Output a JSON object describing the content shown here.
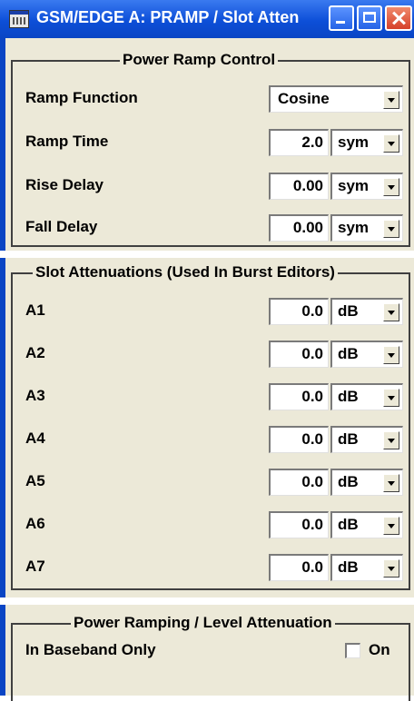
{
  "window": {
    "title": "GSM/EDGE A: PRAMP / Slot Atten"
  },
  "power_ramp_control": {
    "legend": "Power Ramp Control",
    "ramp_function": {
      "label": "Ramp Function",
      "value": "Cosine"
    },
    "ramp_time": {
      "label": "Ramp Time",
      "value": "2.0",
      "unit": "sym"
    },
    "rise_delay": {
      "label": "Rise Delay",
      "value": "0.00",
      "unit": "sym"
    },
    "fall_delay": {
      "label": "Fall Delay",
      "value": "0.00",
      "unit": "sym"
    }
  },
  "slot_attenuations": {
    "legend": "Slot Attenuations (Used In Burst Editors)",
    "items": [
      {
        "label": "A1",
        "value": "0.0",
        "unit": "dB"
      },
      {
        "label": "A2",
        "value": "0.0",
        "unit": "dB"
      },
      {
        "label": "A3",
        "value": "0.0",
        "unit": "dB"
      },
      {
        "label": "A4",
        "value": "0.0",
        "unit": "dB"
      },
      {
        "label": "A5",
        "value": "0.0",
        "unit": "dB"
      },
      {
        "label": "A6",
        "value": "0.0",
        "unit": "dB"
      },
      {
        "label": "A7",
        "value": "0.0",
        "unit": "dB"
      }
    ]
  },
  "power_ramping_level": {
    "legend": "Power Ramping / Level Attenuation",
    "in_baseband_only": {
      "label": "In Baseband Only",
      "checkbox_label": "On",
      "checked": false
    }
  },
  "colors": {
    "titlebar": "#0d4fd8",
    "panel_bg": "#ece9d8",
    "close_button": "#d6402a"
  }
}
